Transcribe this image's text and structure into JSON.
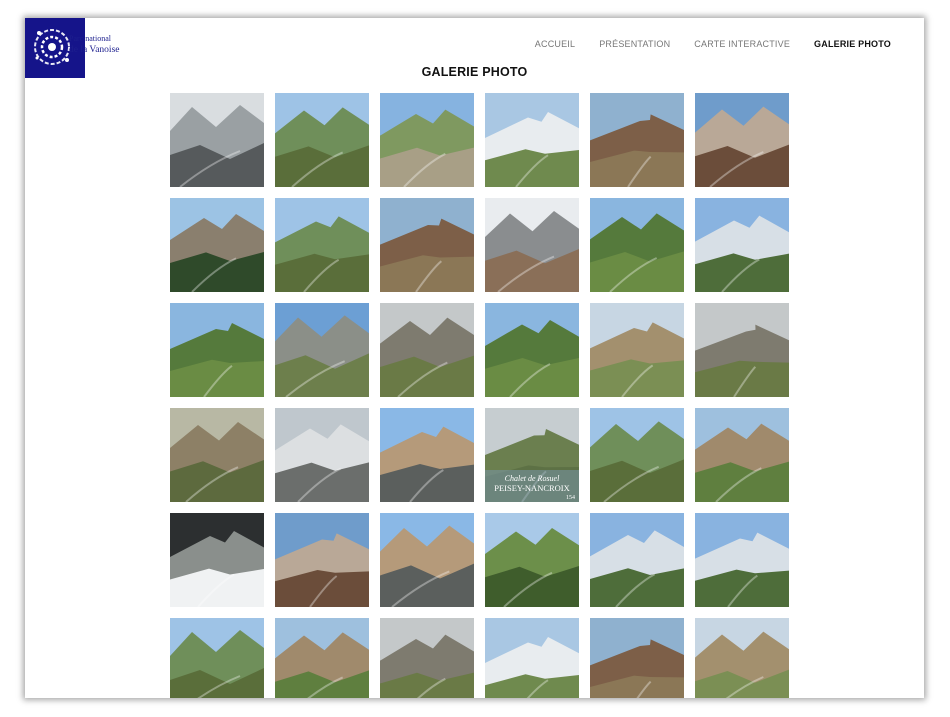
{
  "logo": {
    "line1": "Parc national",
    "line2": "de la Vanoise",
    "color": "#15148a"
  },
  "nav": {
    "items": [
      {
        "label": "ACCUEIL",
        "active": false
      },
      {
        "label": "PRÉSENTATION",
        "active": false
      },
      {
        "label": "CARTE INTERACTIVE",
        "active": false
      },
      {
        "label": "GALERIE PHOTO",
        "active": true
      }
    ]
  },
  "page": {
    "title": "GALERIE PHOTO"
  },
  "gallery": {
    "tiles": [
      {
        "kind": "village-winter"
      },
      {
        "kind": "mountain-valley"
      },
      {
        "kind": "mountain-path"
      },
      {
        "kind": "mountain-snow"
      },
      {
        "kind": "mountain-brown"
      },
      {
        "kind": "mountain-peak"
      },
      {
        "kind": "mountain-forest"
      },
      {
        "kind": "mountain-valley"
      },
      {
        "kind": "mountain-brown"
      },
      {
        "kind": "cable-car"
      },
      {
        "kind": "mountain-green"
      },
      {
        "kind": "mountain-town"
      },
      {
        "kind": "mountain-green"
      },
      {
        "kind": "mountain-lake"
      },
      {
        "kind": "rocky-slope"
      },
      {
        "kind": "mountain-green"
      },
      {
        "kind": "chalet-hill"
      },
      {
        "kind": "rocky-slope"
      },
      {
        "kind": "waterfall"
      },
      {
        "kind": "building-town"
      },
      {
        "kind": "village-street"
      },
      {
        "kind": "captioned",
        "caption1": "Chalet de Rosuel",
        "caption2": "PEISEY-NANCROIX",
        "caption3": "154"
      },
      {
        "kind": "mountain-valley"
      },
      {
        "kind": "village-church"
      },
      {
        "kind": "chalet-snow"
      },
      {
        "kind": "mountain-peak"
      },
      {
        "kind": "village-street"
      },
      {
        "kind": "village-hill"
      },
      {
        "kind": "mountain-town"
      },
      {
        "kind": "mountain-town"
      },
      {
        "kind": "mountain-valley"
      },
      {
        "kind": "village-church"
      },
      {
        "kind": "rocky-slope"
      },
      {
        "kind": "mountain-snow"
      },
      {
        "kind": "mountain-brown"
      },
      {
        "kind": "chalet-hill"
      }
    ]
  }
}
